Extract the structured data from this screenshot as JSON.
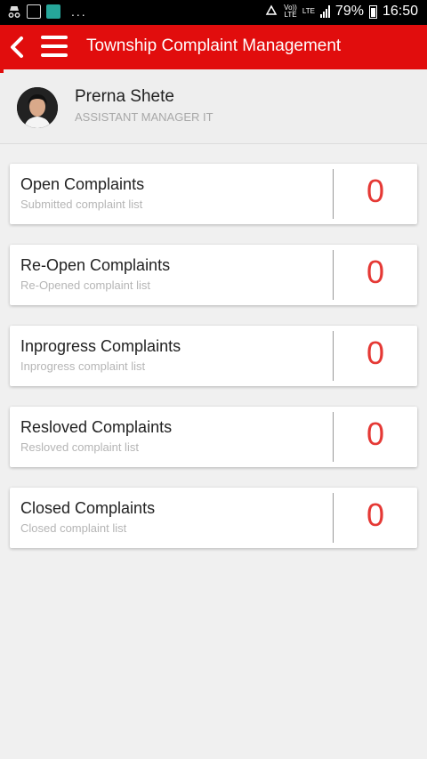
{
  "status_bar": {
    "dots": "...",
    "volte": "Vo))",
    "volte_sub": "LTE",
    "lte": "LTE",
    "battery": "79%",
    "time": "16:50"
  },
  "app_bar": {
    "title": "Township Complaint Management"
  },
  "profile": {
    "name": "Prerna Shete",
    "role": "ASSISTANT MANAGER IT"
  },
  "colors": {
    "primary": "#e10d0d",
    "count": "#e53935"
  },
  "complaints": [
    {
      "title": "Open Complaints",
      "subtitle": "Submitted complaint list",
      "count": "0"
    },
    {
      "title": "Re-Open Complaints",
      "subtitle": "Re-Opened complaint list",
      "count": "0"
    },
    {
      "title": "Inprogress Complaints",
      "subtitle": "Inprogress complaint list",
      "count": "0"
    },
    {
      "title": "Resloved Complaints",
      "subtitle": "Resloved complaint list",
      "count": "0"
    },
    {
      "title": "Closed Complaints",
      "subtitle": "Closed complaint list",
      "count": "0"
    }
  ]
}
